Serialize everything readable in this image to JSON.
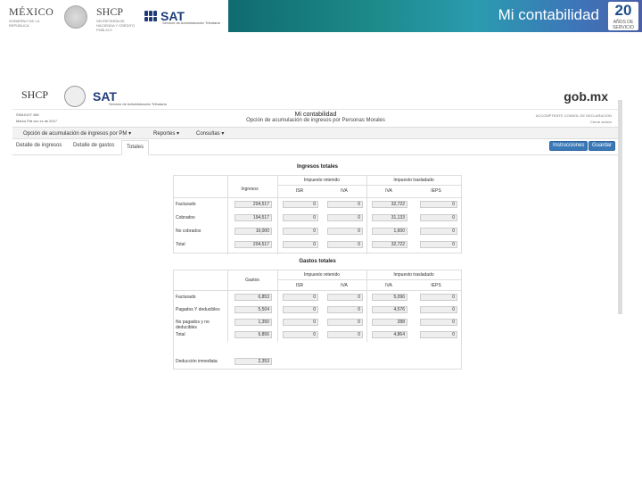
{
  "banner": {
    "title": "Mi contabilidad",
    "mexico": "MÉXICO",
    "mexico_sub": "GOBIERNO DE LA REPÚBLICA",
    "shcp": "SHCP",
    "shcp_sub": "SECRETARÍA DE HACIENDA Y CRÉDITO PÚBLICO",
    "sat": "SAT",
    "sat_sub": "Servicio de Administración Tributaria",
    "logo_number": "20",
    "logo_sub": "AÑOS DE SERVICIO",
    "gradient_colors": [
      "#0f6b70",
      "#2a9bb0",
      "#4a5fa8"
    ]
  },
  "app": {
    "shcp": "SHCP",
    "sat": "SAT",
    "sat_sub": "Servicio de Administración Tributaria",
    "gob": "gob.mx",
    "info_left_1": "SIN10107 456",
    "info_left_2": "Marzo Pat xxx xx de 2017",
    "page_title": "Mi contabilidad",
    "page_subtitle": "Opción de acumulación de ingresos por Personas Morales",
    "info_right_1": "ACCOMPTENTE CONSOL DE DECLARACION",
    "info_right_2": "Cerrar sesión",
    "menu": [
      {
        "label": "Opción de acumulación de ingresos por PM"
      },
      {
        "label": "Reportes"
      },
      {
        "label": "Consultas"
      }
    ],
    "tabs": [
      {
        "label": "Detalle de ingresos"
      },
      {
        "label": "Detalle de gastos"
      },
      {
        "label": "Totales"
      }
    ],
    "btn_instrucciones": "Instrucciones",
    "btn_guardar": "Guardar",
    "accent": "#3a79b8"
  },
  "ingresos": {
    "title": "Ingresos totales",
    "col_ingresos": "Ingresos",
    "grp_retenido": "Impuesto retenido",
    "grp_trasladado": "Impuesto trasladado",
    "col_isr": "ISR",
    "col_iva": "IVA",
    "col_iva2": "IVA",
    "col_ieps": "IEPS",
    "rows": [
      {
        "label": "Facturado",
        "values": [
          "204,517",
          "0",
          "0",
          "32,722",
          "0"
        ]
      },
      {
        "label": "Cobrados",
        "values": [
          "194,517",
          "0",
          "0",
          "31,133",
          "0"
        ]
      },
      {
        "label": "No cobrados",
        "values": [
          "10,000",
          "0",
          "0",
          "1,600",
          "0"
        ]
      },
      {
        "label": "Total",
        "values": [
          "204,517",
          "0",
          "0",
          "32,722",
          "0"
        ]
      }
    ]
  },
  "gastos": {
    "title": "Gastos totales",
    "col_gastos": "Gastos",
    "grp_retenido": "Impuesto retenido",
    "grp_trasladado": "Impuesto trasladado",
    "col_isr": "ISR",
    "col_iva": "IVA",
    "col_iva2": "IVA",
    "col_ieps": "IEPS",
    "rows": [
      {
        "label": "Facturado",
        "values": [
          "6,853",
          "0",
          "0",
          "5,096",
          "0"
        ]
      },
      {
        "label": "Pagados Y deducibles",
        "values": [
          "5,504",
          "0",
          "0",
          "4,576",
          "0"
        ]
      },
      {
        "label": "No pagados y no deducibles",
        "values": [
          "1,350",
          "0",
          "0",
          "288",
          "0"
        ]
      },
      {
        "label": "Total",
        "values": [
          "6,856",
          "0",
          "0",
          "4,864",
          "0"
        ]
      }
    ],
    "deduccion_label": "Deducción inmediata",
    "deduccion_value": "2,353"
  }
}
